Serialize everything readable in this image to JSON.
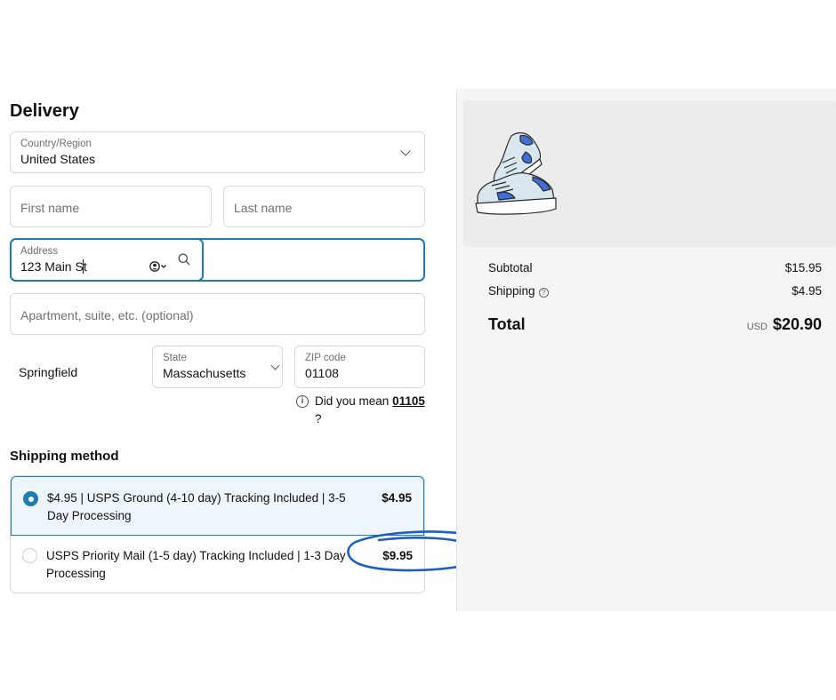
{
  "delivery": {
    "heading": "Delivery",
    "country": {
      "label": "Country/Region",
      "value": "United States"
    },
    "first_name": {
      "placeholder": "First name"
    },
    "last_name": {
      "placeholder": "Last name"
    },
    "address": {
      "label": "Address",
      "value": "123 Main St"
    },
    "apartment": {
      "placeholder": "Apartment, suite, etc. (optional)"
    },
    "city": {
      "value": "Springfield"
    },
    "state": {
      "label": "State",
      "value": "Massachusetts"
    },
    "zip": {
      "label": "ZIP code",
      "value": "01108"
    },
    "zip_suggestion": {
      "prefix": "Did you mean",
      "suggested": "01105",
      "suffix": "?"
    }
  },
  "shipping": {
    "heading": "Shipping method",
    "options": [
      {
        "label": "$4.95 | USPS Ground (4-10 day) Tracking Included | 3-5 Day Processing",
        "price": "$4.95",
        "selected": true
      },
      {
        "label": "USPS Priority Mail (1-5 day) Tracking Included | 1-3 Day Processing",
        "price": "$9.95",
        "selected": false
      }
    ]
  },
  "summary": {
    "subtotal_label": "Subtotal",
    "subtotal_value": "$15.95",
    "shipping_label": "Shipping",
    "shipping_value": "$4.95",
    "total_label": "Total",
    "currency": "USD",
    "total_value": "$20.90"
  },
  "icons": {
    "country_dropdown": "chevron-down-icon",
    "address_search": "search-icon",
    "address_contact": "contact-icon",
    "state_dropdown": "chevron-down-icon",
    "zip_info": "info-icon",
    "shipping_help": "question-circle-icon",
    "product_image": "sneakers-illustration"
  },
  "colors": {
    "accent": "#1e7bb4",
    "selected_bg": "#eef5fb",
    "summary_bg": "#f5f5f5",
    "annotation": "#1a5fc4"
  }
}
